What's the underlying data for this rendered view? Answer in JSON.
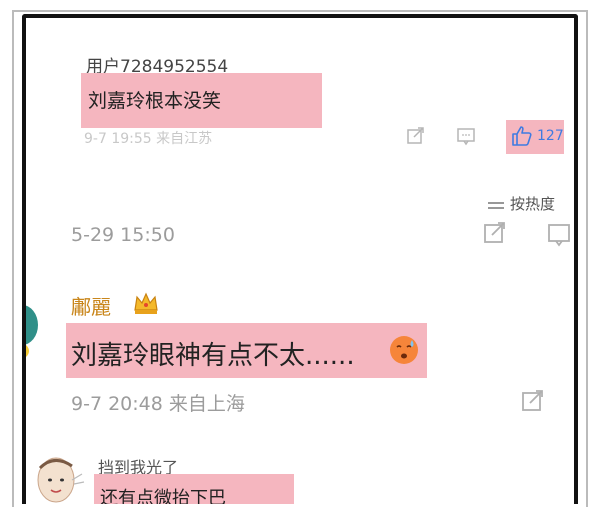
{
  "comment1": {
    "username": "用户7284952554",
    "text": "刘嘉玲根本没笑",
    "meta": "9-7 19:55  来自江苏",
    "like_count": "127"
  },
  "sort_label": "按热度",
  "post": {
    "timestamp": "5-29 15:50"
  },
  "comment2": {
    "username": "鄘麗",
    "text": "刘嘉玲眼神有点不太......",
    "meta": "9-7 20:48  来自上海"
  },
  "comment3": {
    "username": "挡到我光了",
    "text": "还有点微抬下巴"
  },
  "colors": {
    "highlight": "#f5b6bf",
    "like_blue": "#3f7be2",
    "gold_username": "#c9861b"
  }
}
